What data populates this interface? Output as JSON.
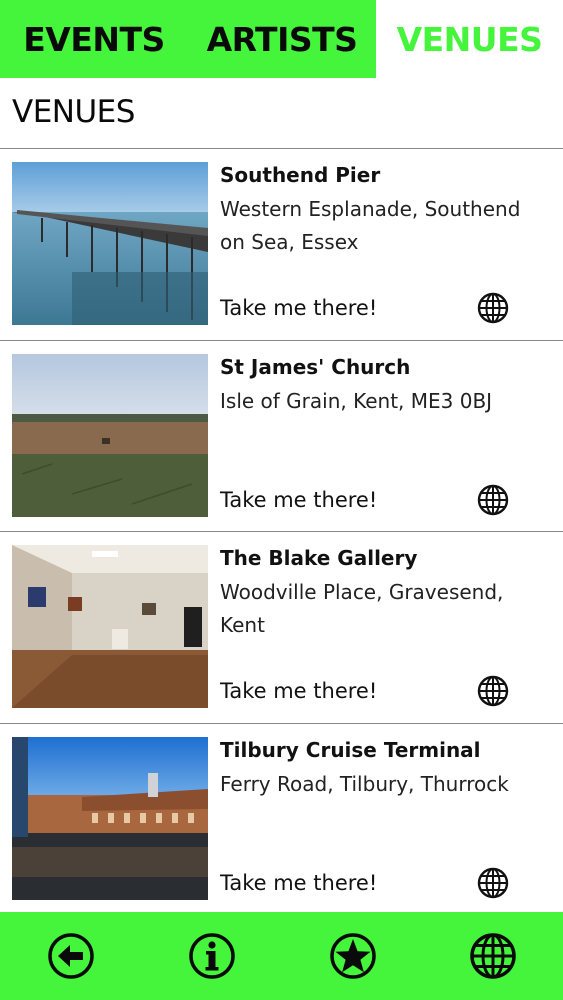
{
  "tabs": [
    {
      "label": "EVENTS",
      "active": false
    },
    {
      "label": "ARTISTS",
      "active": false
    },
    {
      "label": "VENUES",
      "active": true
    }
  ],
  "page_title": "VENUES",
  "venues": [
    {
      "name": "Southend Pier",
      "address": "Western Esplanade, Southend on Sea, Essex",
      "link_label": "Take me there!",
      "photo": "pier-over-sea",
      "icon": "globe-icon"
    },
    {
      "name": "St James' Church",
      "address": "Isle of Grain, Kent, ME3 0BJ",
      "link_label": "Take me there!",
      "photo": "flat-field-landscape",
      "icon": "globe-icon"
    },
    {
      "name": "The Blake Gallery",
      "address": "Woodville Place, Gravesend, Kent",
      "link_label": "Take me there!",
      "photo": "gallery-interior",
      "icon": "globe-icon"
    },
    {
      "name": "Tilbury Cruise Terminal",
      "address": "Ferry Road, Tilbury, Thurrock",
      "link_label": "Take me there!",
      "photo": "terminal-building-waterfront",
      "icon": "globe-icon"
    }
  ],
  "bottom_bar": {
    "buttons": [
      "back-arrow-icon",
      "info-icon",
      "star-icon",
      "globe-icon"
    ]
  },
  "colors": {
    "accent": "#44f53b",
    "text": "#0a0a0a",
    "divider": "#888888"
  }
}
